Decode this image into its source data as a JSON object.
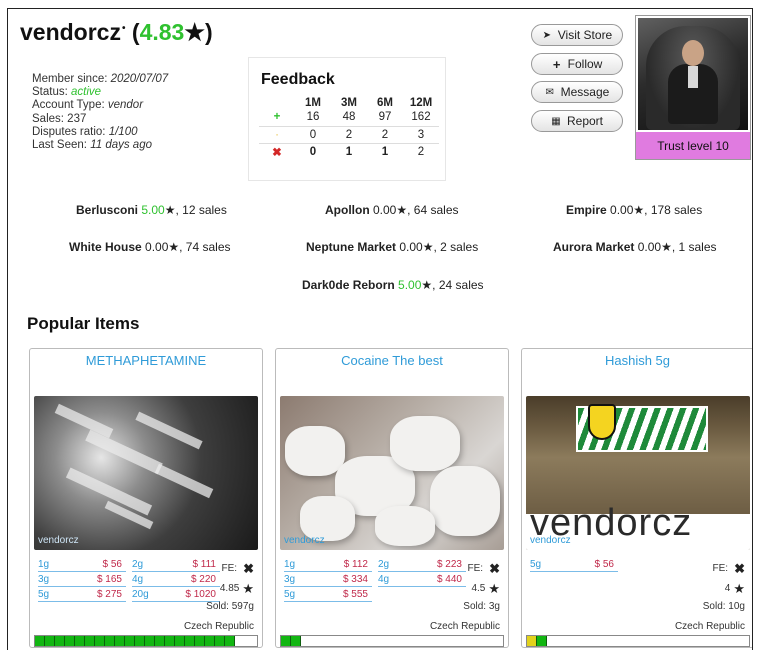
{
  "vendor": {
    "name": "vendorcz",
    "seal": "•",
    "rating": "4.83",
    "rating_star": "★",
    "open_paren": "(",
    "close_paren": ")"
  },
  "member_info": {
    "member_since_label": "Member since:",
    "member_since": "2020/07/07",
    "status_label": "Status:",
    "status": "active",
    "account_type_label": "Account Type:",
    "account_type": "vendor",
    "sales_label": "Sales:",
    "sales": "237",
    "disputes_label": "Disputes ratio:",
    "disputes": "1/100",
    "last_seen_label": "Last Seen:",
    "last_seen": "11 days ago"
  },
  "feedback": {
    "title": "Feedback",
    "columns": [
      "1M",
      "3M",
      "6M",
      "12M"
    ],
    "rows": [
      {
        "icon": "+",
        "icon_name": "positive-icon",
        "values": [
          "16",
          "48",
          "97",
          "162"
        ]
      },
      {
        "icon": "·",
        "icon_name": "neutral-icon",
        "values": [
          "0",
          "2",
          "2",
          "3"
        ]
      },
      {
        "icon": "✖",
        "icon_name": "negative-icon",
        "values": [
          "0",
          "1",
          "1",
          "2"
        ]
      }
    ]
  },
  "buttons": {
    "visit_store": {
      "label": "Visit Store",
      "icon": "➤"
    },
    "follow": {
      "label": "Follow",
      "icon": "+"
    },
    "message": {
      "label": "Message",
      "icon": "✉"
    },
    "report": {
      "label": "Report",
      "icon": "▦"
    }
  },
  "trust_level": "Trust level 10",
  "markets": [
    {
      "name": "Berlusconi",
      "rating": "5.00",
      "green": true,
      "sales": ", 12 sales"
    },
    {
      "name": "Apollon",
      "rating": "0.00",
      "green": false,
      "sales": ", 64 sales"
    },
    {
      "name": "Empire",
      "rating": "0.00",
      "green": false,
      "sales": ", 178 sales"
    },
    {
      "name": "White House",
      "rating": "0.00",
      "green": false,
      "sales": ", 74 sales"
    },
    {
      "name": "Neptune Market",
      "rating": "0.00",
      "green": false,
      "sales": ", 2 sales"
    },
    {
      "name": "Aurora Market",
      "rating": "0.00",
      "green": false,
      "sales": ", 1 sales"
    },
    {
      "name": "Dark0de Reborn",
      "rating": "5.00",
      "green": true,
      "sales": ", 24 sales"
    }
  ],
  "star_glyph": "★",
  "popular_heading": "Popular Items",
  "items": [
    {
      "title": "METHAPHETAMINE",
      "watermark": "vendorcz",
      "prices": [
        [
          {
            "q": "1g",
            "p": "$ 56"
          },
          {
            "q": "2g",
            "p": "$ 111"
          }
        ],
        [
          {
            "q": "3g",
            "p": "$ 165"
          },
          {
            "q": "4g",
            "p": "$ 220"
          }
        ],
        [
          {
            "q": "5g",
            "p": "$ 275"
          },
          {
            "q": "20g",
            "p": "$ 1020"
          }
        ]
      ],
      "fe_label": "FE:",
      "fe_icon": "✖",
      "rating": "4.85",
      "sold": "Sold: 597g",
      "country": "Czech Republic",
      "trust_fill": {
        "green": 20,
        "yellow": 0
      }
    },
    {
      "title": "Cocaine The best",
      "watermark": "vendorcz",
      "prices": [
        [
          {
            "q": "1g",
            "p": "$ 112"
          },
          {
            "q": "2g",
            "p": "$ 223"
          }
        ],
        [
          {
            "q": "3g",
            "p": "$ 334"
          },
          {
            "q": "4g",
            "p": "$ 440"
          }
        ],
        [
          {
            "q": "5g",
            "p": "$ 555"
          }
        ]
      ],
      "fe_label": "FE:",
      "fe_icon": "✖",
      "rating": "4.5",
      "sold": "Sold: 3g",
      "country": "Czech Republic",
      "trust_fill": {
        "green": 2,
        "yellow": 0
      }
    },
    {
      "title": "Hashish 5g",
      "watermark": "vendorcz",
      "image_text": "vendorcz",
      "prices": [
        [
          {
            "q": "5g",
            "p": "$ 56"
          }
        ]
      ],
      "fe_label": "FE:",
      "fe_icon": "✖",
      "rating": "4",
      "sold": "Sold: 10g",
      "country": "Czech Republic",
      "trust_fill": {
        "green": 1,
        "yellow": 1
      }
    }
  ]
}
